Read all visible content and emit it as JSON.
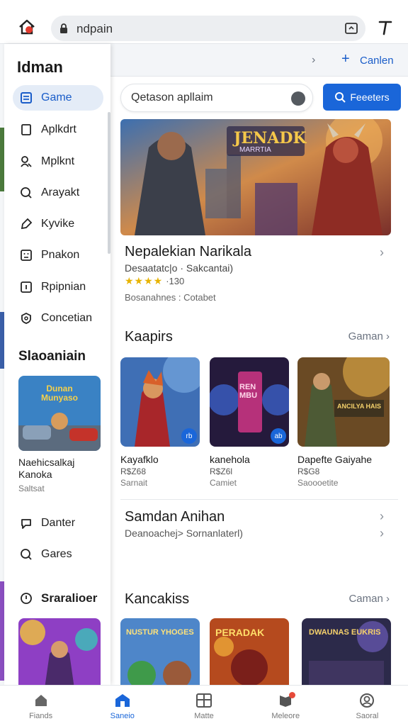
{
  "browser": {
    "url": "ndpain"
  },
  "drawer": {
    "title": "Idman",
    "items": [
      {
        "label": "Game",
        "icon": "list-icon",
        "active": true
      },
      {
        "label": "Aplkdrt",
        "icon": "file-icon"
      },
      {
        "label": "Mplknt",
        "icon": "user-icon"
      },
      {
        "label": "Arayakt",
        "icon": "search-icon"
      },
      {
        "label": "Kyvike",
        "icon": "tag-icon"
      },
      {
        "label": "Pnakon",
        "icon": "face-icon"
      },
      {
        "label": "Rpipnian",
        "icon": "info-icon"
      },
      {
        "label": "Concetian",
        "icon": "shield-icon"
      }
    ],
    "section": "Slaoaniain",
    "card": {
      "title": "Naehicsalkaj Kanoka",
      "sub": "Saltsat",
      "thumb_text": "Dunan Munyaso"
    },
    "items2": [
      {
        "label": "Danter",
        "icon": "chat-icon"
      },
      {
        "label": "Gares",
        "icon": "search-icon"
      }
    ],
    "section2": "Sraralioer"
  },
  "main": {
    "header": {
      "chevron": "›",
      "link_icon": "+",
      "link": "Canlen"
    },
    "search": {
      "placeholder": "Qetason apllaim"
    },
    "filter_button": "Feeeters",
    "hero": {
      "banner_title": "JENADK",
      "banner_sub": "MARRTIA",
      "title": "Nepalekian Narikala",
      "sub": "Desaatatc|o · Sakcantai)",
      "stars": "★★★★",
      "rating_count": "·130",
      "meta": "Bosanahnes : Cotabet"
    },
    "section1": {
      "title": "Kaapirs",
      "link": "Gaman",
      "cards": [
        {
          "title": "Kayafklo",
          "price": "R$Z68",
          "sub": "Sarnait",
          "badge": "rb"
        },
        {
          "title": "kanehola",
          "price": "R$Z6l",
          "sub": "Camiet",
          "badge": "ab",
          "thumb_text": "RENMBU"
        },
        {
          "title": "Dapefte Gaiyahe",
          "price": "R$G8",
          "sub": "Saoooetite",
          "badge": "",
          "thumb_text": "ANCILYA HAIS"
        }
      ]
    },
    "row": {
      "title": "Samdan Anihan",
      "sub": "Deanoachej> Sornanlaterl)"
    },
    "section2": {
      "title": "Kancakiss",
      "link": "Caman",
      "cards": [
        {
          "thumb_text": "NUSTUR YHOGES"
        },
        {
          "thumb_text": "PERADAK"
        },
        {
          "thumb_text": "DWAUNAS EUKRIS"
        }
      ]
    }
  },
  "bottom_nav": [
    {
      "label": "Fiands",
      "icon": "home-icon"
    },
    {
      "label": "Saneio",
      "icon": "store-icon",
      "active": true
    },
    {
      "label": "Matte",
      "icon": "grid-icon"
    },
    {
      "label": "Meleore",
      "icon": "notification-icon",
      "dot": true
    },
    {
      "label": "Saoral",
      "icon": "profile-icon"
    }
  ]
}
